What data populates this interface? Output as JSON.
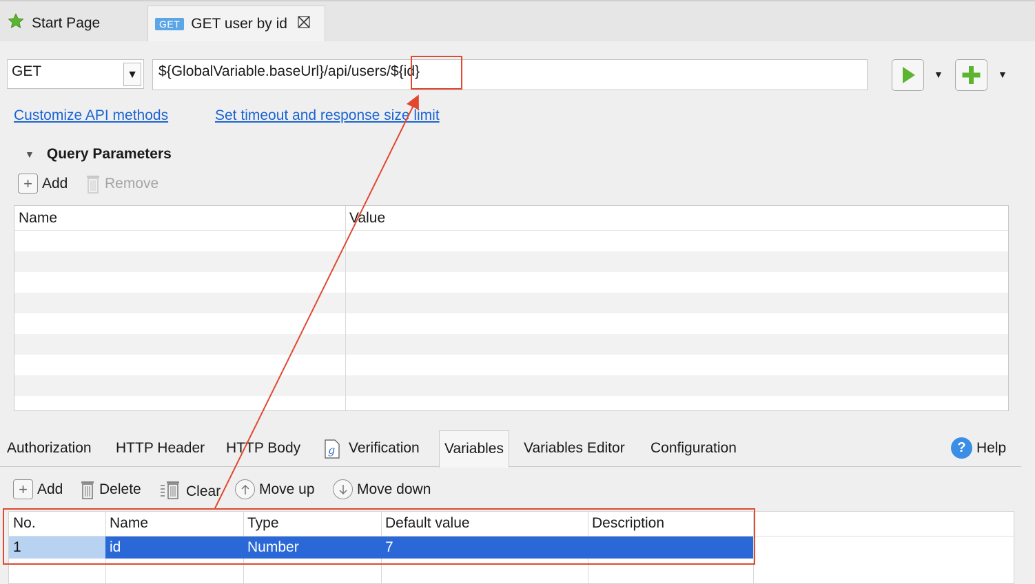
{
  "tabs": [
    {
      "label": "Start Page",
      "icon": "star-icon"
    },
    {
      "label": "GET user by id",
      "badge": "GET",
      "icon": "close-icon"
    }
  ],
  "request": {
    "method": "GET",
    "url": "${GlobalVariable.baseUrl}/api/users/${id}"
  },
  "links": {
    "customize": "Customize API methods",
    "timeout": "Set timeout and response size limit"
  },
  "query": {
    "title": "Query Parameters",
    "add": "Add",
    "remove": "Remove",
    "columns": [
      "Name",
      "Value"
    ]
  },
  "bottom_tabs": [
    "Authorization",
    "HTTP Header",
    "HTTP Body",
    "Verification",
    "Variables",
    "Variables Editor",
    "Configuration"
  ],
  "active_tab": "Variables",
  "help": "Help",
  "variables_toolbar": {
    "add": "Add",
    "delete": "Delete",
    "clear": "Clear",
    "move_up": "Move up",
    "move_down": "Move down"
  },
  "variables_table": {
    "columns": [
      "No.",
      "Name",
      "Type",
      "Default value",
      "Description"
    ],
    "rows": [
      {
        "no": "1",
        "name": "id",
        "type": "Number",
        "default": "7",
        "description": ""
      }
    ]
  },
  "colors": {
    "accent": "#2a68d8",
    "highlight": "#e2472f",
    "link": "#1a64d4",
    "run_green": "#5cb531"
  }
}
